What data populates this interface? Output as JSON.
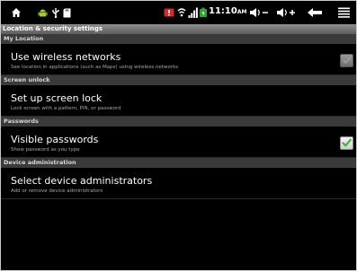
{
  "status_bar": {
    "time": "11:10",
    "am_pm": "AM",
    "icons": [
      "home-icon",
      "android-icon",
      "usb-icon",
      "sd-card-icon",
      "warning-icon",
      "wifi-icon",
      "signal-icon",
      "battery-icon",
      "volume-down-icon",
      "volume-up-icon",
      "back-icon",
      "menu-icon"
    ],
    "colors": {
      "accent_check": "#3fb33a",
      "battery": "#34a034"
    }
  },
  "app": {
    "title": "Location & security settings"
  },
  "sections": [
    {
      "header": "My Location",
      "items": [
        {
          "title": "Use wireless networks",
          "summary": "See location in applications (such as Maps) using wireless networks",
          "checkbox": "unchecked"
        }
      ]
    },
    {
      "header": "Screen unlock",
      "items": [
        {
          "title": "Set up screen lock",
          "summary": "Lock screen with a pattern, PIN, or password"
        }
      ]
    },
    {
      "header": "Passwords",
      "items": [
        {
          "title": "Visible passwords",
          "summary": "Show password as you type",
          "checkbox": "checked"
        }
      ]
    },
    {
      "header": "Device administration",
      "items": [
        {
          "title": "Select device administrators",
          "summary": "Add or remove device administrators"
        }
      ]
    }
  ]
}
